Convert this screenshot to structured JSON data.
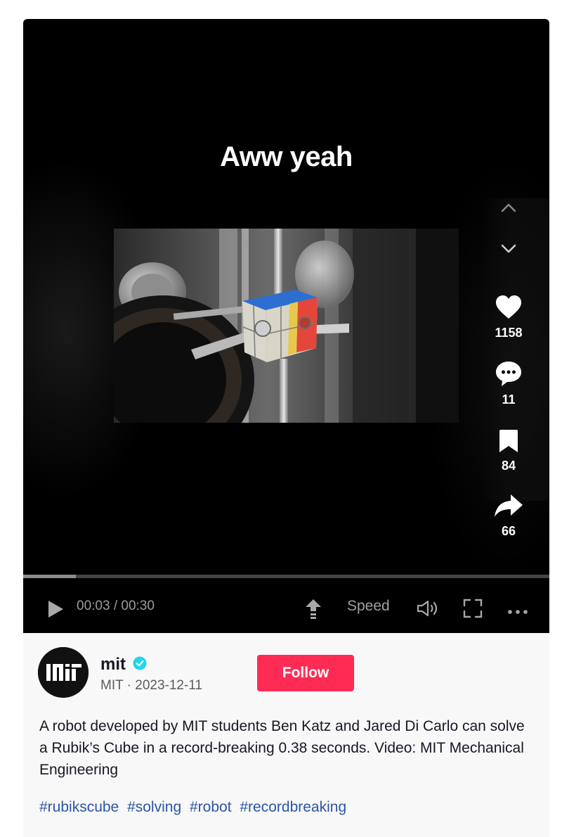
{
  "video": {
    "overlay_caption": "Aww yeah",
    "progress_fraction": 0.1,
    "time_display": "00:03 / 00:30",
    "speed_label": "Speed"
  },
  "actions": {
    "likes": "1158",
    "comments": "11",
    "saves": "84",
    "shares": "66"
  },
  "author": {
    "name": "mit",
    "meta": "MIT · 2023-12-11",
    "verified": true,
    "follow_label": "Follow",
    "avatar_logo_text": "MIT"
  },
  "post": {
    "description": "A robot developed by MIT students Ben Katz and Jared Di Carlo can solve a Rubik’s Cube in a record-breaking 0.38 seconds. Video: MIT Mechanical Engineering",
    "hashtags": [
      "#rubikscube",
      "#solving",
      "#robot",
      "#recordbreaking"
    ]
  },
  "colors": {
    "follow": "#fe2c55",
    "hashtag": "#2b55a5",
    "verified": "#20d5ec"
  },
  "icons": [
    "chevron-up-icon",
    "chevron-down-icon",
    "heart-icon",
    "comment-icon",
    "bookmark-icon",
    "share-icon",
    "play-icon",
    "pip-icon",
    "volume-icon",
    "fullscreen-icon",
    "more-icon",
    "verified-icon"
  ]
}
